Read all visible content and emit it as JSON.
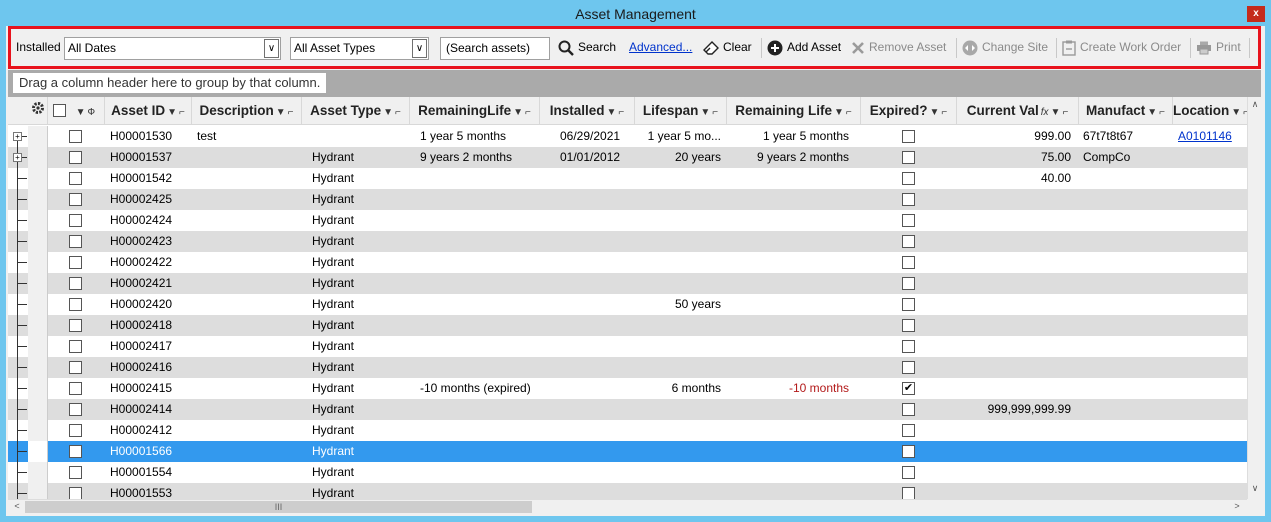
{
  "window": {
    "title": "Asset Management",
    "close_label": "x"
  },
  "toolbar": {
    "installed_label": "Installed",
    "date_filter": "All Dates",
    "type_filter": "All Asset Types",
    "search_value": "(Search assets)",
    "search_label": "Search",
    "advanced_label": "Advanced...",
    "clear_label": "Clear",
    "add_label": "Add Asset",
    "remove_label": "Remove Asset",
    "change_site_label": "Change Site",
    "work_order_label": "Create Work Order",
    "print_label": "Print"
  },
  "group_hint": "Drag a column header here to group by that column.",
  "columns": [
    {
      "key": "id",
      "label": "Asset ID"
    },
    {
      "key": "desc",
      "label": "Description"
    },
    {
      "key": "type",
      "label": "Asset Type"
    },
    {
      "key": "remaining",
      "label": "RemainingLife"
    },
    {
      "key": "installed",
      "label": "Installed"
    },
    {
      "key": "lifespan",
      "label": "Lifespan"
    },
    {
      "key": "remaining2",
      "label": "Remaining Life"
    },
    {
      "key": "expired",
      "label": "Expired?"
    },
    {
      "key": "value",
      "label": "Current Val"
    },
    {
      "key": "manuf",
      "label": "Manufact"
    },
    {
      "key": "location",
      "label": "Location"
    }
  ],
  "rows": [
    {
      "id": "H00001530",
      "desc": "test",
      "type": "",
      "remaining": "1 year 5 months",
      "installed": "06/29/2021",
      "lifespan": "1 year 5 mo...",
      "remaining2": "1 year 5 months",
      "expired": false,
      "value": "999.00",
      "manuf": "67t7t8t67",
      "location": "A0101146",
      "expand": true
    },
    {
      "id": "H00001537",
      "desc": "",
      "type": "Hydrant",
      "remaining": "9 years 2 months",
      "installed": "01/01/2012",
      "lifespan": "20 years",
      "remaining2": "9 years 2 months",
      "expired": false,
      "value": "75.00",
      "manuf": "CompCo",
      "location": "",
      "expand": true
    },
    {
      "id": "H00001542",
      "desc": "",
      "type": "Hydrant",
      "remaining": "",
      "installed": "",
      "lifespan": "",
      "remaining2": "",
      "expired": false,
      "value": "40.00",
      "manuf": "",
      "location": ""
    },
    {
      "id": "H00002425",
      "desc": "",
      "type": "Hydrant",
      "remaining": "",
      "installed": "",
      "lifespan": "",
      "remaining2": "",
      "expired": false,
      "value": "",
      "manuf": "",
      "location": ""
    },
    {
      "id": "H00002424",
      "desc": "",
      "type": "Hydrant",
      "remaining": "",
      "installed": "",
      "lifespan": "",
      "remaining2": "",
      "expired": false,
      "value": "",
      "manuf": "",
      "location": ""
    },
    {
      "id": "H00002423",
      "desc": "",
      "type": "Hydrant",
      "remaining": "",
      "installed": "",
      "lifespan": "",
      "remaining2": "",
      "expired": false,
      "value": "",
      "manuf": "",
      "location": ""
    },
    {
      "id": "H00002422",
      "desc": "",
      "type": "Hydrant",
      "remaining": "",
      "installed": "",
      "lifespan": "",
      "remaining2": "",
      "expired": false,
      "value": "",
      "manuf": "",
      "location": ""
    },
    {
      "id": "H00002421",
      "desc": "",
      "type": "Hydrant",
      "remaining": "",
      "installed": "",
      "lifespan": "",
      "remaining2": "",
      "expired": false,
      "value": "",
      "manuf": "",
      "location": ""
    },
    {
      "id": "H00002420",
      "desc": "",
      "type": "Hydrant",
      "remaining": "",
      "installed": "",
      "lifespan": "50 years",
      "remaining2": "",
      "expired": false,
      "value": "",
      "manuf": "",
      "location": ""
    },
    {
      "id": "H00002418",
      "desc": "",
      "type": "Hydrant",
      "remaining": "",
      "installed": "",
      "lifespan": "",
      "remaining2": "",
      "expired": false,
      "value": "",
      "manuf": "",
      "location": ""
    },
    {
      "id": "H00002417",
      "desc": "",
      "type": "Hydrant",
      "remaining": "",
      "installed": "",
      "lifespan": "",
      "remaining2": "",
      "expired": false,
      "value": "",
      "manuf": "",
      "location": ""
    },
    {
      "id": "H00002416",
      "desc": "",
      "type": "Hydrant",
      "remaining": "",
      "installed": "",
      "lifespan": "",
      "remaining2": "",
      "expired": false,
      "value": "",
      "manuf": "",
      "location": ""
    },
    {
      "id": "H00002415",
      "desc": "",
      "type": "Hydrant",
      "remaining": "-10 months (expired)",
      "installed": "",
      "lifespan": "6 months",
      "remaining2": "-10 months",
      "expired": true,
      "value": "",
      "manuf": "",
      "location": ""
    },
    {
      "id": "H00002414",
      "desc": "",
      "type": "Hydrant",
      "remaining": "",
      "installed": "",
      "lifespan": "",
      "remaining2": "",
      "expired": false,
      "value": "999,999,999.99",
      "manuf": "",
      "location": ""
    },
    {
      "id": "H00002412",
      "desc": "",
      "type": "Hydrant",
      "remaining": "",
      "installed": "",
      "lifespan": "",
      "remaining2": "",
      "expired": false,
      "value": "",
      "manuf": "",
      "location": ""
    },
    {
      "id": "H00001566",
      "desc": "",
      "type": "Hydrant",
      "remaining": "",
      "installed": "",
      "lifespan": "",
      "remaining2": "",
      "expired": false,
      "value": "",
      "manuf": "",
      "location": "",
      "selected": true
    },
    {
      "id": "H00001554",
      "desc": "",
      "type": "Hydrant",
      "remaining": "",
      "installed": "",
      "lifespan": "",
      "remaining2": "",
      "expired": false,
      "value": "",
      "manuf": "",
      "location": ""
    },
    {
      "id": "H00001553",
      "desc": "",
      "type": "Hydrant",
      "remaining": "",
      "installed": "",
      "lifespan": "",
      "remaining2": "",
      "expired": false,
      "value": "",
      "manuf": "",
      "location": ""
    }
  ],
  "colors": {
    "accent_border": "#e8121c",
    "selection": "#3399ee",
    "title_bar": "#6ec6ee",
    "negative": "#b31a1a"
  },
  "scroll_grip": "III"
}
